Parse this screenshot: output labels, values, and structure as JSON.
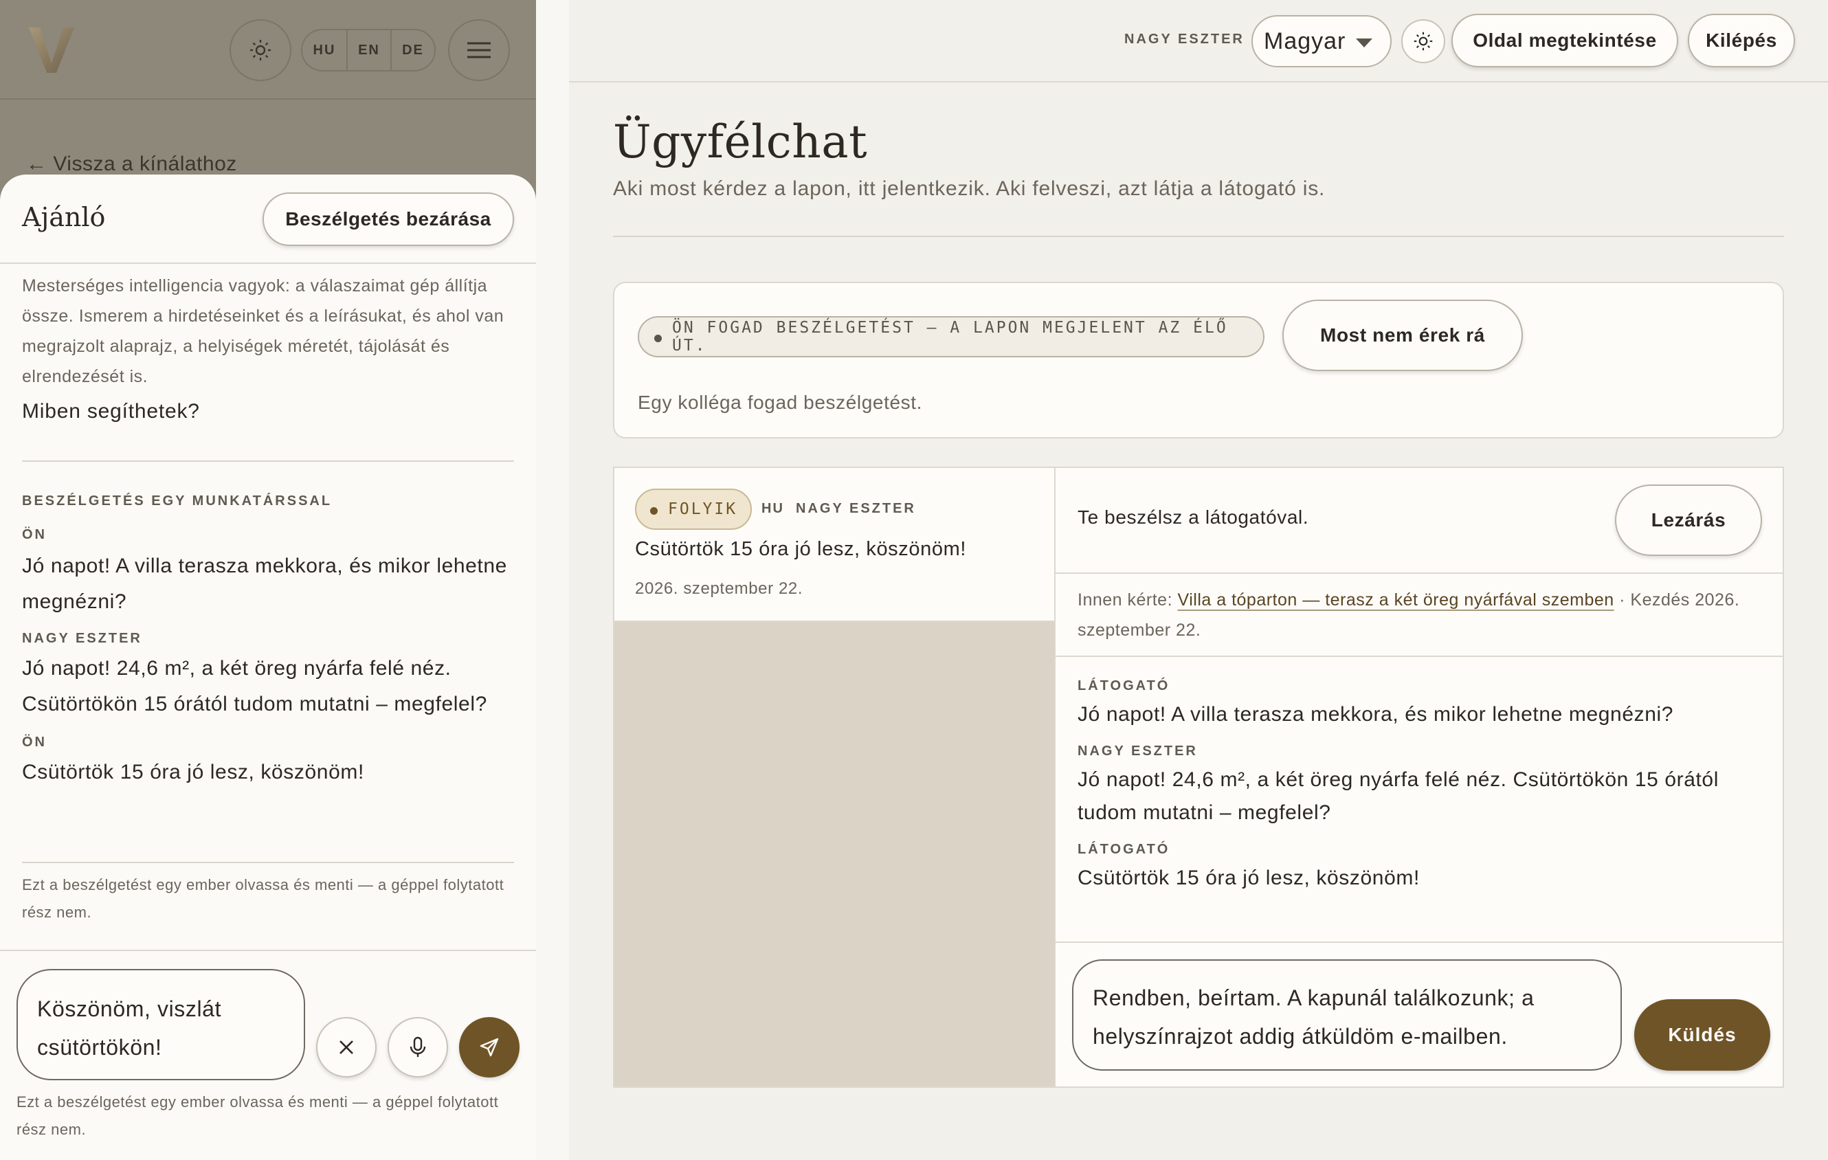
{
  "left": {
    "langs": [
      "HU",
      "EN",
      "DE"
    ],
    "back_link": "← Vissza a kínálathoz",
    "drawer": {
      "title": "Ajánló",
      "close_button": "Beszélgetés bezárása",
      "ai_intro": "Mesterséges intelligencia vagyok: a válaszaimat gép állítja össze. Ismerem a hirdetéseinket és a leírásukat, és ahol van megrajzolt alaprajz, a helyiségek méretét, tájolását és elrendezését is.",
      "ai_question": "Miben segíthetek?",
      "section_label": "BESZÉLGETÉS EGY MUNKATÁRSSAL",
      "messages": [
        {
          "sender": "ÖN",
          "text": "Jó napot! A villa terasza mekkora, és mikor lehetne megnézni?"
        },
        {
          "sender": "NAGY ESZTER",
          "text": "Jó napot! 24,6 m², a két öreg nyárfa felé néz. Csütörtökön 15 órától tudom mutatni – megfelel?"
        },
        {
          "sender": "ÖN",
          "text": "Csütörtök 15 óra jó lesz, köszönöm!"
        }
      ],
      "note": "Ezt a beszélgetést egy ember olvassa és menti — a géppel folytatott rész nem."
    },
    "input": {
      "value": "Köszönöm, viszlát csütörtökön!",
      "note": "Ezt a beszélgetést egy ember olvassa és menti — a géppel folytatott rész nem."
    }
  },
  "topbar": {
    "user": "NAGY ESZTER",
    "language": "Magyar",
    "view_page": "Oldal megtekintése",
    "logout": "Kilépés"
  },
  "page": {
    "title": "Ügyfélchat",
    "subtitle": "Aki most kérdez a lapon, itt jelentkezik. Aki felveszi, azt látja a látogató is."
  },
  "status": {
    "badge": "ÖN FOGAD BESZÉLGETÉST — A LAPON MEGJELENT AZ ÉLŐ ÚT.",
    "not_now": "Most nem érek rá",
    "note": "Egy kolléga fogad beszélgetést."
  },
  "conversation_list": [
    {
      "status": "FOLYIK",
      "lang": "HU",
      "agent": "NAGY ESZTER",
      "last_message": "Csütörtök 15 óra jó lesz, köszönöm!",
      "date": "2026. szeptember 22."
    }
  ],
  "detail": {
    "status_text": "Te beszélsz a látogatóval.",
    "close": "Lezárás",
    "meta_prefix": "Innen kérte: ",
    "meta_link": "Villa a tóparton — terasz a két öreg nyárfával szemben",
    "meta_suffix": " · Kezdés 2026. szeptember 22.",
    "messages": [
      {
        "sender": "LÁTOGATÓ",
        "text": "Jó napot! A villa terasza mekkora, és mikor lehetne megnézni?"
      },
      {
        "sender": "NAGY ESZTER",
        "text": "Jó napot! 24,6 m², a két öreg nyárfa felé néz. Csütörtökön 15 órától tudom mutatni – megfelel?"
      },
      {
        "sender": "LÁTOGATÓ",
        "text": "Csütörtök 15 óra jó lesz, köszönöm!"
      }
    ],
    "reply_value": "Rendben, beírtam. A kapunál találkozunk; a helyszínrajzot addig átküldöm e-mailben.",
    "send": "Küldés"
  },
  "colors": {
    "accent": "#6f5428",
    "overlay": "#8e887a",
    "background": "#f2f0eb"
  },
  "icons": [
    "logo-v-icon",
    "sun-icon",
    "menu-icon",
    "close-icon",
    "mic-icon",
    "send-icon",
    "caret-down-icon"
  ]
}
